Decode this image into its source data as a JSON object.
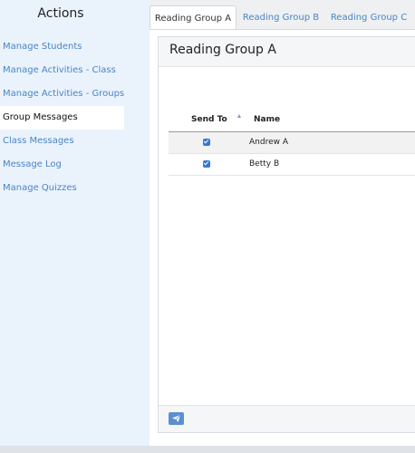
{
  "sidebar": {
    "title": "Actions",
    "items": [
      {
        "label": "Manage Students"
      },
      {
        "label": "Manage Activities - Class"
      },
      {
        "label": "Manage Activities - Groups"
      },
      {
        "label": "Group Messages"
      },
      {
        "label": "Class Messages"
      },
      {
        "label": "Message Log"
      },
      {
        "label": "Manage Quizzes"
      }
    ]
  },
  "tabs": [
    {
      "label": "Reading Group A"
    },
    {
      "label": "Reading Group B"
    },
    {
      "label": "Reading Group C"
    }
  ],
  "panel": {
    "title": "Reading Group A",
    "columns": {
      "send_to": "Send To",
      "name": "Name"
    },
    "rows": [
      {
        "name": "Andrew A",
        "checked": true
      },
      {
        "name": "Betty B",
        "checked": true
      }
    ],
    "send_icon": "paper-plane-icon"
  },
  "colors": {
    "accent": "#4a84c4",
    "sidebar_bg": "#eaf3fc",
    "checkbox": "#3478d4"
  }
}
